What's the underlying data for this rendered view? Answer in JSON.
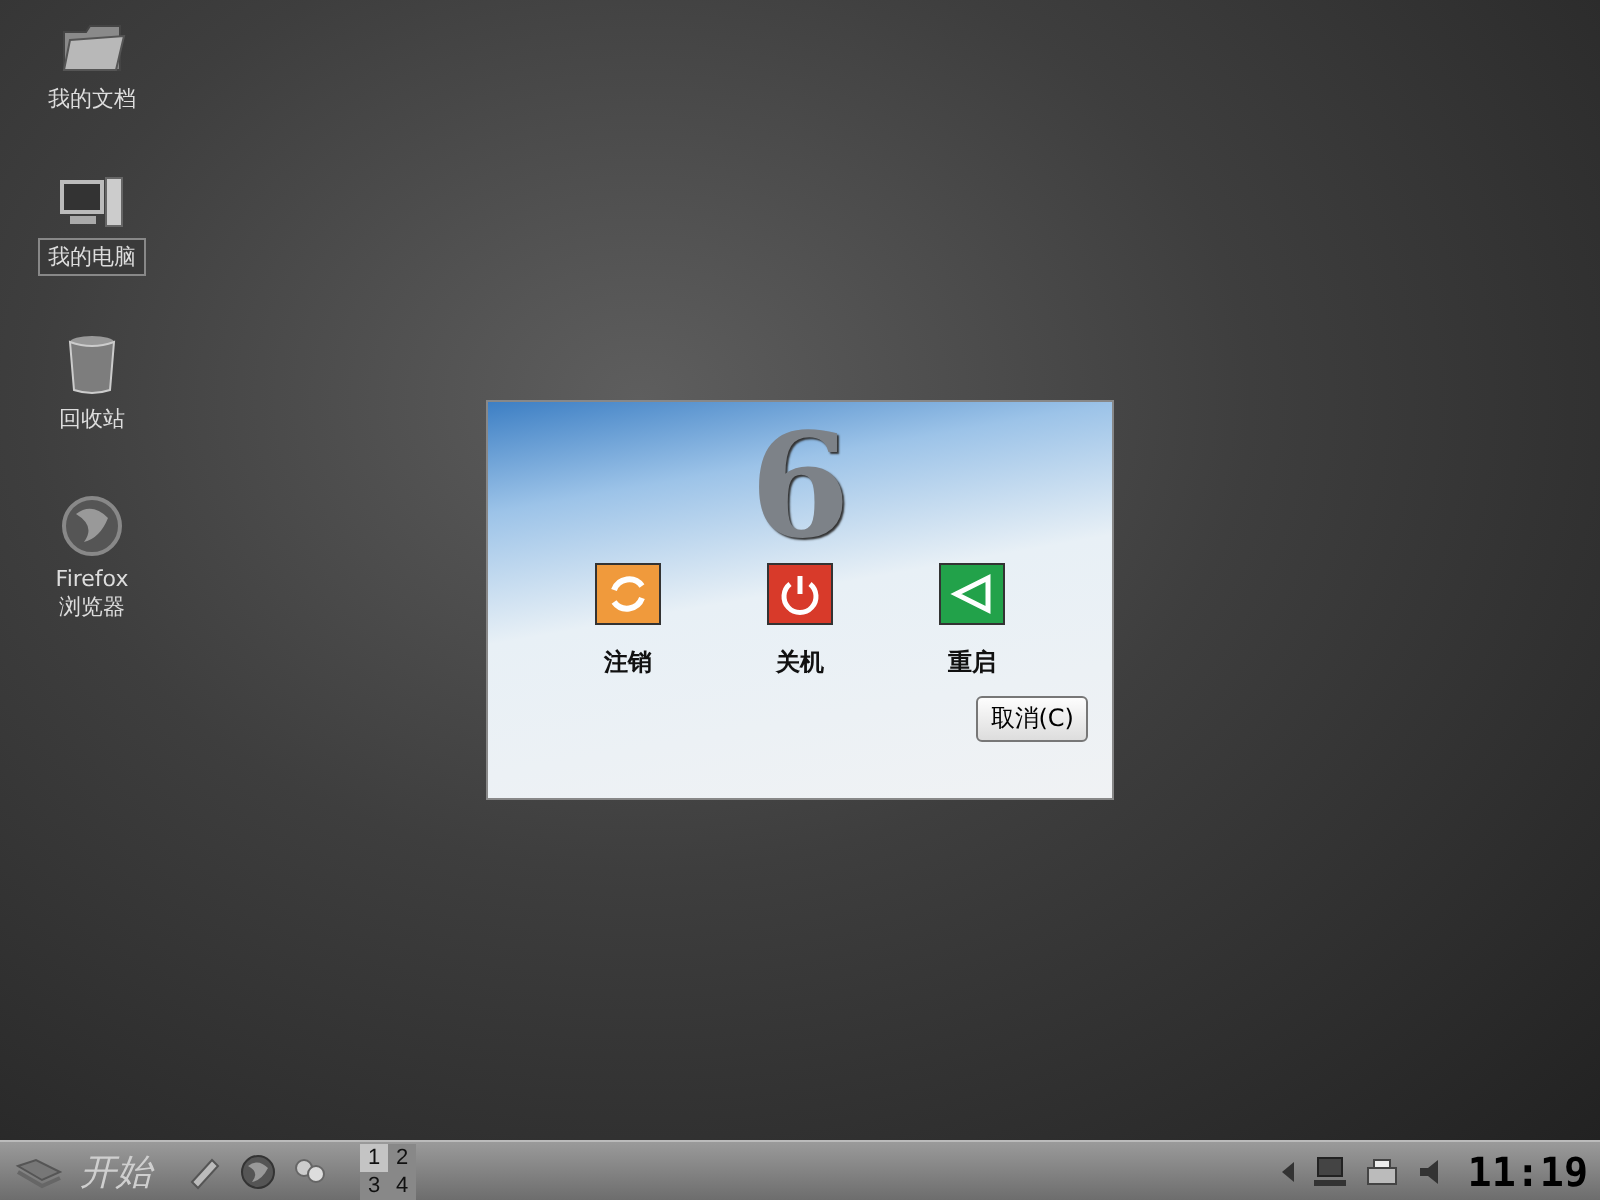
{
  "desktop_icons": [
    {
      "label": "我的文档",
      "kind": "folder",
      "selected": false
    },
    {
      "label": "我的电脑",
      "kind": "computer",
      "selected": true
    },
    {
      "label": "回收站",
      "kind": "trash",
      "selected": false
    },
    {
      "label": "Firefox 浏览器",
      "kind": "browser",
      "selected": false
    }
  ],
  "dialog": {
    "logo_text": "6",
    "actions": [
      {
        "label": "注销",
        "kind": "logout"
      },
      {
        "label": "关机",
        "kind": "shutdown"
      },
      {
        "label": "重启",
        "kind": "restart"
      }
    ],
    "cancel_button": "取消(C)"
  },
  "taskbar": {
    "start_label": "开始",
    "pager": [
      {
        "label": "1",
        "selected": true
      },
      {
        "label": "2",
        "selected": false
      },
      {
        "label": "3",
        "selected": false
      },
      {
        "label": "4",
        "selected": false
      }
    ],
    "clock": "11:19"
  }
}
